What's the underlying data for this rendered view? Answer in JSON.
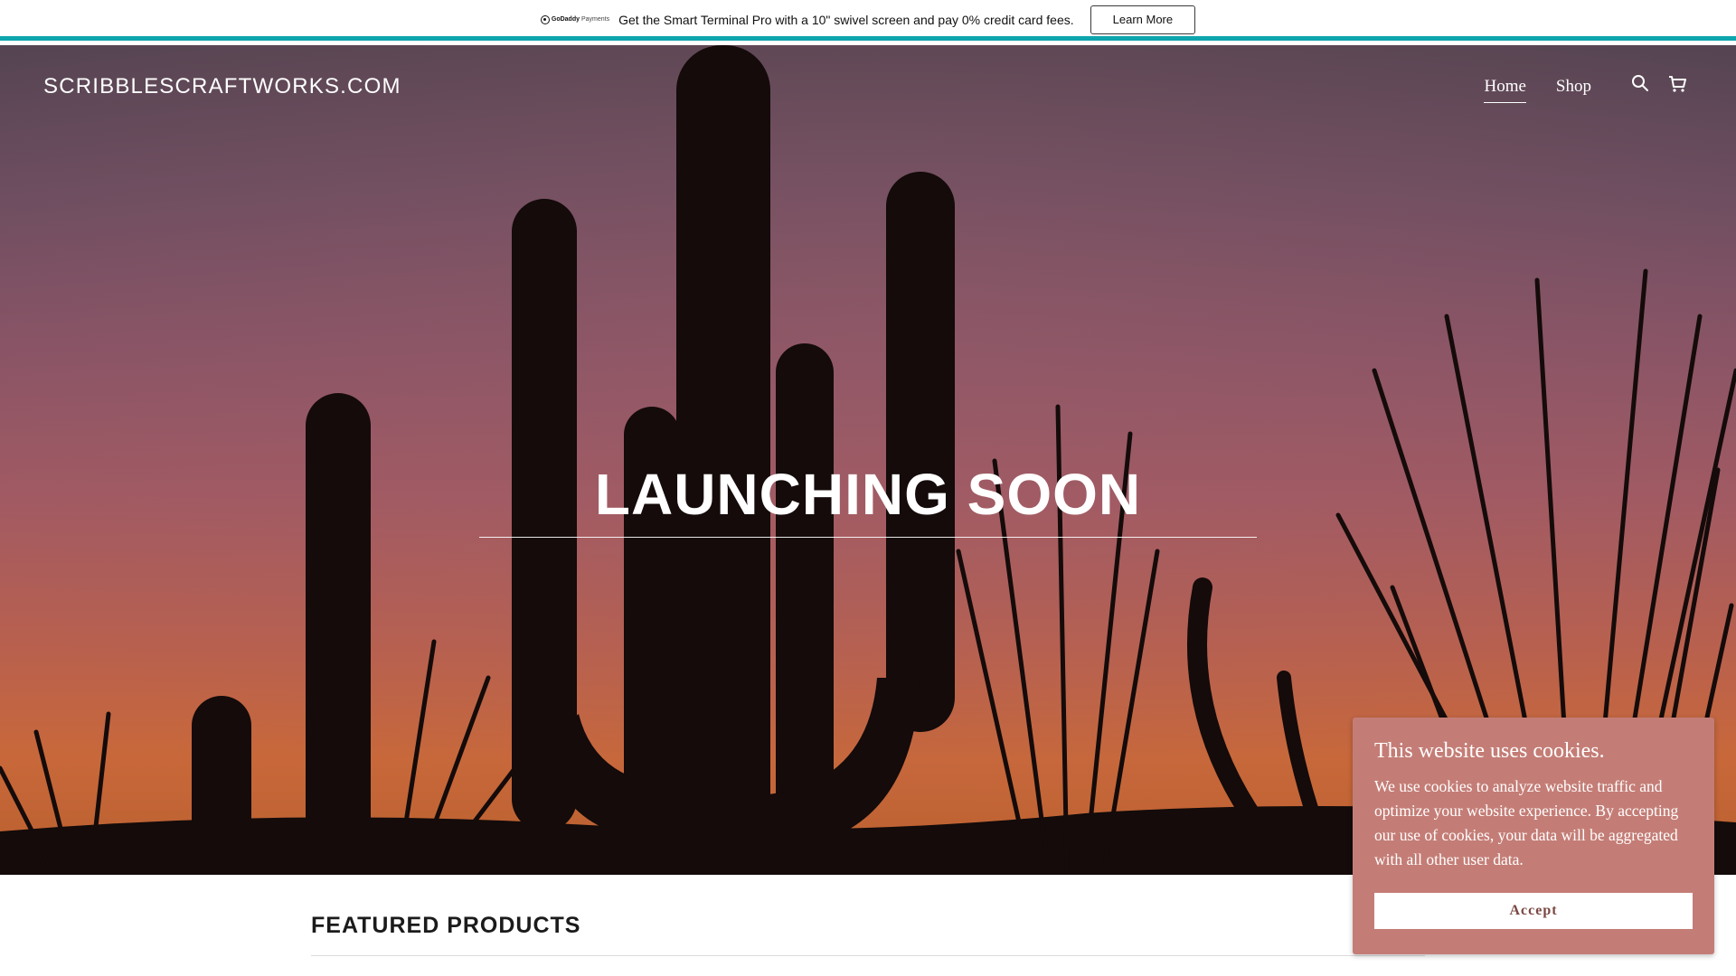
{
  "promo": {
    "logo_brand": "GoDaddy",
    "logo_product": "Payments",
    "text": "Get the Smart Terminal Pro with a 10\" swivel screen and pay 0% credit card fees.",
    "button_label": "Learn More",
    "accent_color": "#0ea5ad"
  },
  "header": {
    "brand": "SCRIBBLESCRAFTWORKS.COM",
    "nav": [
      {
        "label": "Home",
        "active": true
      },
      {
        "label": "Shop",
        "active": false
      }
    ],
    "icons": [
      "search-icon",
      "cart-icon"
    ]
  },
  "hero": {
    "title": "LAUNCHING SOON"
  },
  "featured": {
    "title": "FEATURED PRODUCTS"
  },
  "cookie": {
    "title": "This website uses cookies.",
    "body": "We use cookies to analyze website traffic and optimize your website experience. By accepting our use of cookies, your data will be aggregated with all other user data.",
    "button_label": "Accept",
    "background_color": "#c47d76"
  }
}
